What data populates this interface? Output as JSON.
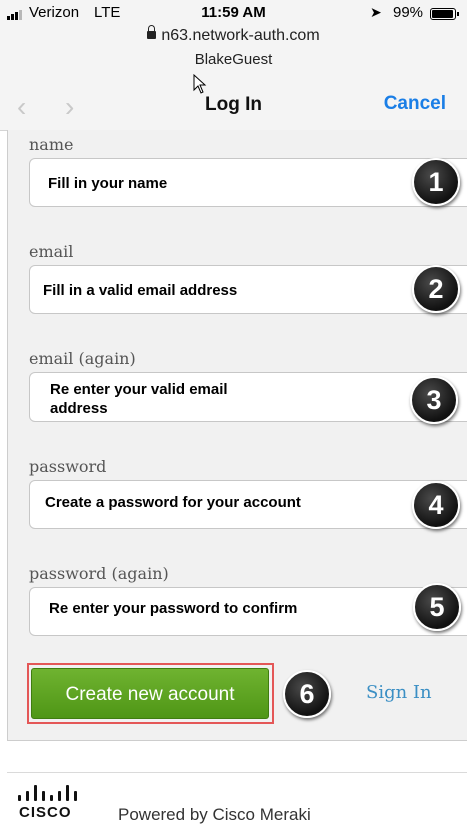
{
  "status_bar": {
    "carrier": "Verizon",
    "network": "LTE",
    "time": "11:59 AM",
    "battery_percent": "99%"
  },
  "browser": {
    "url": "n63.network-auth.com",
    "ssid": "BlakeGuest",
    "title": "Log In",
    "cancel_label": "Cancel",
    "back_symbol": "‹",
    "forward_symbol": "›"
  },
  "form": {
    "fields": [
      {
        "label": "name",
        "instruction": "Fill in your name",
        "step": "1"
      },
      {
        "label": "email",
        "instruction": "Fill in a valid email address",
        "step": "2"
      },
      {
        "label": "email (again)",
        "instruction": "Re enter your valid email address",
        "step": "3"
      },
      {
        "label": "password",
        "instruction": "Create a password for your account",
        "step": "4"
      },
      {
        "label": "password (again)",
        "instruction": "Re enter your password to confirm",
        "step": "5"
      }
    ],
    "create_button_label": "Create new account",
    "create_step": "6",
    "sign_in_label": "Sign In"
  },
  "footer": {
    "brand": "CISCO",
    "powered_by": "Powered by Cisco Meraki"
  },
  "colors": {
    "accent_blue": "#1a7ee6",
    "button_green": "#5ea623",
    "highlight_red": "#e45757",
    "sign_in_blue": "#3b8fc4"
  }
}
